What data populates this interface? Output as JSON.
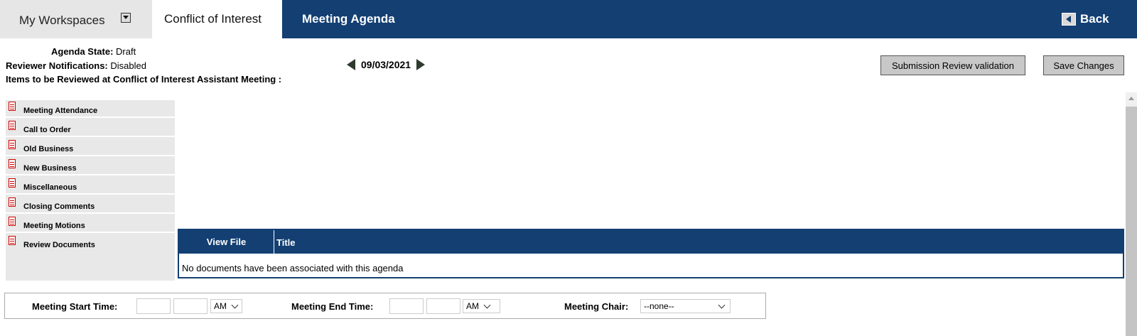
{
  "tabs": {
    "workspaces": "My Workspaces",
    "active": "Conflict of Interest",
    "page_title": "Meeting Agenda",
    "back": "Back"
  },
  "info": {
    "agenda_state_label": "Agenda State:",
    "agenda_state_value": "Draft",
    "notifications_label": "Reviewer Notifications:",
    "notifications_value": "Disabled",
    "items_heading": "Items to be Reviewed at Conflict of Interest Assistant Meeting :"
  },
  "date_nav": {
    "date": "09/03/2021"
  },
  "buttons": {
    "submission_review": "Submission Review validation",
    "save": "Save Changes"
  },
  "sidebar": {
    "items": [
      {
        "label": "Meeting Attendance"
      },
      {
        "label": "Call to Order"
      },
      {
        "label": "Old Business"
      },
      {
        "label": "New Business"
      },
      {
        "label": "Miscellaneous"
      },
      {
        "label": "Closing Comments"
      },
      {
        "label": "Meeting Motions"
      },
      {
        "label": "Review Documents"
      }
    ]
  },
  "documents": {
    "col_view_file": "View File",
    "col_title": "Title",
    "empty_message": "No documents have been associated with this agenda"
  },
  "meeting_times": {
    "start_label": "Meeting Start Time:",
    "start_ampm": "AM",
    "end_label": "Meeting End Time:",
    "end_ampm": "AM",
    "chair_label": "Meeting Chair:",
    "chair_value": "--none--"
  },
  "colors": {
    "brand": "#133f73"
  }
}
